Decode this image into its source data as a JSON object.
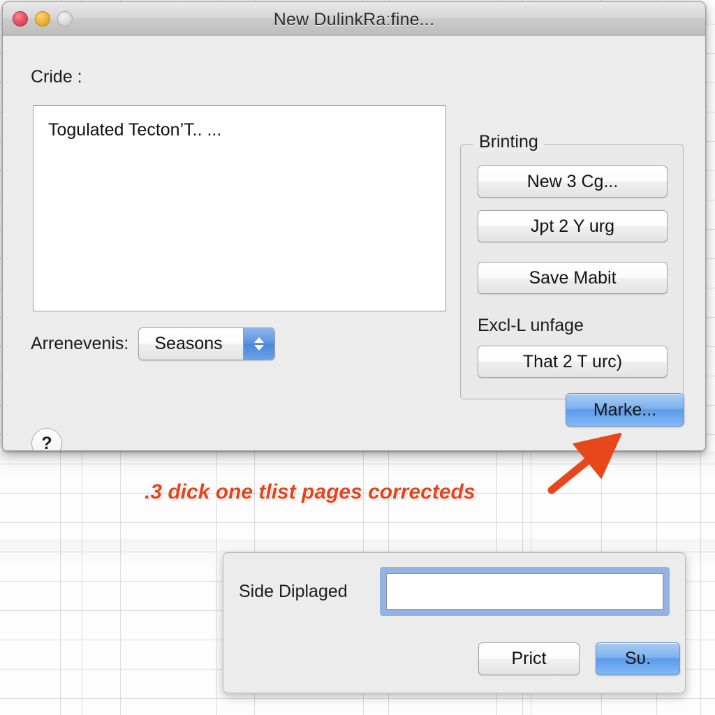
{
  "window": {
    "title": "New DulinkRaːfine...",
    "traffic_lights": {
      "close": "close-button",
      "minimize": "minimize-button",
      "zoom": "zoom-button"
    }
  },
  "form": {
    "code_label": "Cride :",
    "code_text": "Togulated Tecton’T.. ...",
    "arrangement_label": "Arrenevenis:",
    "arrangement_value": "Seasons"
  },
  "printing_group": {
    "title": "Brinting",
    "buttons": [
      {
        "label": "New 3 Cg..."
      },
      {
        "label": "Jƿt 2 Y urg"
      },
      {
        "label": "Save Mabit"
      }
    ],
    "sub_label": "Excl-L unfage",
    "sub_button": {
      "label": "That 2 T urc)"
    }
  },
  "footer": {
    "help_label": "?",
    "primary_button": "Marke..."
  },
  "annotation": {
    "text": ".3 dick one tlist pages correcteds",
    "color": "#e1451c"
  },
  "bottom_dialog": {
    "field_label": "Side Diplaged",
    "field_value": "",
    "field_placeholder": "",
    "secondary_button": "Prict",
    "primary_button": "Sʋ."
  },
  "colors": {
    "window_body": "#ececec",
    "accent_blue": "#5c9ae9",
    "annotation_orange": "#e1451c",
    "grid_line": "#d5d5d5"
  }
}
